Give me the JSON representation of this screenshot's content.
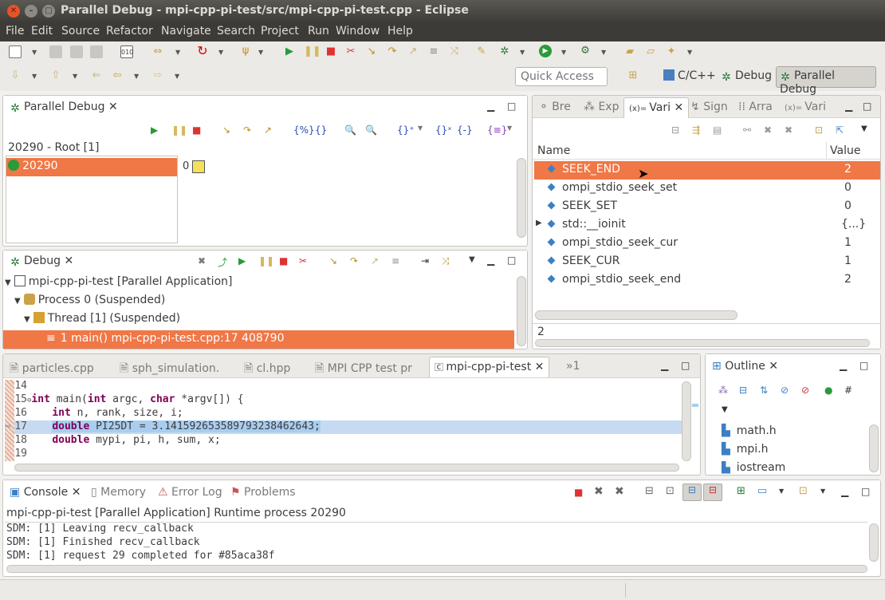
{
  "window": {
    "title": "Parallel Debug - mpi-cpp-pi-test/src/mpi-cpp-pi-test.cpp - Eclipse"
  },
  "menu": [
    "File",
    "Edit",
    "Source",
    "Refactor",
    "Navigate",
    "Search",
    "Project",
    "Run",
    "Window",
    "Help"
  ],
  "quick_access": {
    "placeholder": "Quick Access"
  },
  "perspectives": [
    "C/C++",
    "Debug",
    "Parallel Debug"
  ],
  "parallel_debug": {
    "tab": "Parallel Debug",
    "root_label": "20290 - Root [1]",
    "job": "20290",
    "task_index": "0"
  },
  "variables": {
    "tabs": [
      "Bre",
      "Exp",
      "Vari",
      "Sign",
      "Arra",
      "Vari"
    ],
    "col_name": "Name",
    "col_value": "Value",
    "rows": [
      {
        "name": "SEEK_END",
        "value": "2"
      },
      {
        "name": "ompi_stdio_seek_set",
        "value": "0"
      },
      {
        "name": "SEEK_SET",
        "value": "0"
      },
      {
        "name": "std::__ioinit",
        "value": "{...}"
      },
      {
        "name": "ompi_stdio_seek_cur",
        "value": "1"
      },
      {
        "name": "SEEK_CUR",
        "value": "1"
      },
      {
        "name": "ompi_stdio_seek_end",
        "value": "2"
      }
    ],
    "detail": "2"
  },
  "debug": {
    "tab": "Debug",
    "tree": [
      "mpi-cpp-pi-test [Parallel Application]",
      "Process 0 (Suspended)",
      "Thread [1] (Suspended)",
      "1 main() mpi-cpp-pi-test.cpp:17 408790"
    ]
  },
  "editor": {
    "tabs": [
      "particles.cpp",
      "sph_simulation.",
      "cl.hpp",
      "MPI CPP test pr",
      "mpi-cpp-pi-test"
    ],
    "overflow": "»1",
    "lines": [
      {
        "num": "14",
        "code": ""
      },
      {
        "num": "15",
        "code": "int main(int argc, char *argv[]) {"
      },
      {
        "num": "16",
        "code": "    int n, rank, size, i;"
      },
      {
        "num": "17",
        "code": "    double PI25DT = 3.141592653589793238462643;"
      },
      {
        "num": "18",
        "code": "    double mypi, pi, h, sum, x;"
      },
      {
        "num": "19",
        "code": ""
      }
    ]
  },
  "outline": {
    "tab": "Outline",
    "items": [
      "math.h",
      "mpi.h",
      "iostream"
    ]
  },
  "console": {
    "tabs": [
      "Console",
      "Memory",
      "Error Log",
      "Problems"
    ],
    "header": "mpi-cpp-pi-test [Parallel Application] Runtime process 20290",
    "lines": [
      "SDM: [1] Leaving recv_callback",
      "SDM: [1] Finished recv_callback",
      "SDM: [1] request 29 completed for #85aca38f"
    ]
  }
}
